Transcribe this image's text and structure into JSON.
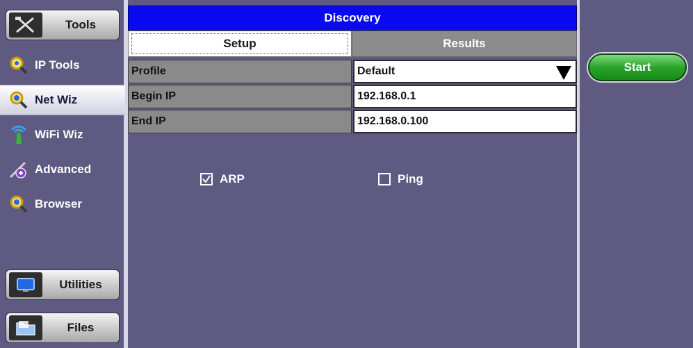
{
  "sidebar": {
    "tools_label": "Tools",
    "items": [
      {
        "label": "IP Tools",
        "icon": "magnifier-icon"
      },
      {
        "label": "Net Wiz",
        "icon": "magnifier-icon",
        "active": true
      },
      {
        "label": "WiFi Wiz",
        "icon": "antenna-icon"
      },
      {
        "label": "Advanced",
        "icon": "advanced-icon"
      },
      {
        "label": "Browser",
        "icon": "magnifier-icon"
      }
    ],
    "utilities_label": "Utilities",
    "files_label": "Files"
  },
  "panel": {
    "title": "Discovery",
    "tabs": [
      {
        "label": "Setup",
        "active": true
      },
      {
        "label": "Results",
        "active": false
      }
    ],
    "fields": [
      {
        "label": "Profile",
        "value": "Default"
      },
      {
        "label": "Begin IP",
        "value": "192.168.0.1"
      },
      {
        "label": "End IP",
        "value": "192.168.0.100"
      }
    ],
    "options": [
      {
        "label": "ARP",
        "checked": true
      },
      {
        "label": "Ping",
        "checked": false
      }
    ]
  },
  "actions": {
    "start_label": "Start"
  },
  "colors": {
    "background": "#5e5a82",
    "title_bar": "#0a0af0",
    "start_button": "#2aa42a"
  }
}
